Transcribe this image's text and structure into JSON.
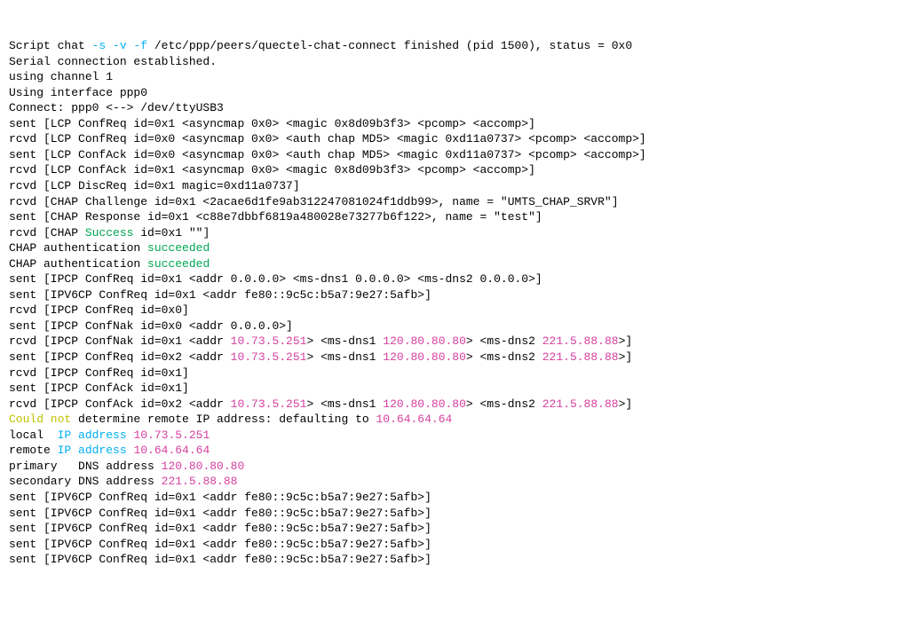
{
  "t": {
    "l01a": "Script chat ",
    "l01b": "-s -v -f",
    "l01c": " /etc/ppp/peers/quectel-chat-connect finished (pid 1500), status = 0x0",
    "l02": "Serial connection established.",
    "l03": "using channel 1",
    "l04": "Using interface ppp0",
    "l05": "Connect: ppp0 <--> /dev/ttyUSB3",
    "l06": "sent [LCP ConfReq id=0x1 <asyncmap 0x0> <magic 0x8d09b3f3> <pcomp> <accomp>]",
    "l07": "rcvd [LCP ConfReq id=0x0 <asyncmap 0x0> <auth chap MD5> <magic 0xd11a0737> <pcomp> <accomp>]",
    "l08": "sent [LCP ConfAck id=0x0 <asyncmap 0x0> <auth chap MD5> <magic 0xd11a0737> <pcomp> <accomp>]",
    "l09": "rcvd [LCP ConfAck id=0x1 <asyncmap 0x0> <magic 0x8d09b3f3> <pcomp> <accomp>]",
    "l10": "rcvd [LCP DiscReq id=0x1 magic=0xd11a0737]",
    "l11": "rcvd [CHAP Challenge id=0x1 <2acae6d1fe9ab312247081024f1ddb99>, name = \"UMTS_CHAP_SRVR\"]",
    "l12": "sent [CHAP Response id=0x1 <c88e7dbbf6819a480028e73277b6f122>, name = \"test\"]",
    "l13a": "rcvd [CHAP ",
    "l13b": "Success",
    "l13c": " id=0x1 \"\"]",
    "l14a": "CHAP authentication ",
    "l14b": "succeeded",
    "l15a": "CHAP authentication ",
    "l15b": "succeeded",
    "l16": "sent [IPCP ConfReq id=0x1 <addr 0.0.0.0> <ms-dns1 0.0.0.0> <ms-dns2 0.0.0.0>]",
    "l17": "sent [IPV6CP ConfReq id=0x1 <addr fe80::9c5c:b5a7:9e27:5afb>]",
    "l18": "rcvd [IPCP ConfReq id=0x0]",
    "l19": "sent [IPCP ConfNak id=0x0 <addr 0.0.0.0>]",
    "l20a": "rcvd [IPCP ConfNak id=0x1 <addr ",
    "ip1": "10.73.5.251",
    "l20b": "> <ms-dns1 ",
    "dns1": "120.80.80.80",
    "l20c": "> <ms-dns2 ",
    "dns2": "221.5.88.88",
    "l20d": ">]",
    "l21a": "sent [IPCP ConfReq id=0x2 <addr ",
    "l21b": "> <ms-dns1 ",
    "l21c": "> <ms-dns2 ",
    "l21d": ">]",
    "l22": "rcvd [IPCP ConfReq id=0x1]",
    "l23": "sent [IPCP ConfAck id=0x1]",
    "l24a": "rcvd [IPCP ConfAck id=0x2 <addr ",
    "l24b": "> <ms-dns1 ",
    "l24c": "> <ms-dns2 ",
    "l24d": ">]",
    "l25a": "Could not",
    "l25b": " determine remote IP address: defaulting to ",
    "defip": "10.64.64.64",
    "l26a": "local  ",
    "ipaddr": "IP address",
    "sp": " ",
    "l27a": "remote ",
    "l28a": "primary   DNS address ",
    "l29a": "secondary DNS address ",
    "l30": "sent [IPV6CP ConfReq id=0x1 <addr fe80::9c5c:b5a7:9e27:5afb>]",
    "l31": "sent [IPV6CP ConfReq id=0x1 <addr fe80::9c5c:b5a7:9e27:5afb>]",
    "l32": "sent [IPV6CP ConfReq id=0x1 <addr fe80::9c5c:b5a7:9e27:5afb>]",
    "l33": "sent [IPV6CP ConfReq id=0x1 <addr fe80::9c5c:b5a7:9e27:5afb>]",
    "l34": "sent [IPV6CP ConfReq id=0x1 <addr fe80::9c5c:b5a7:9e27:5afb>]"
  }
}
